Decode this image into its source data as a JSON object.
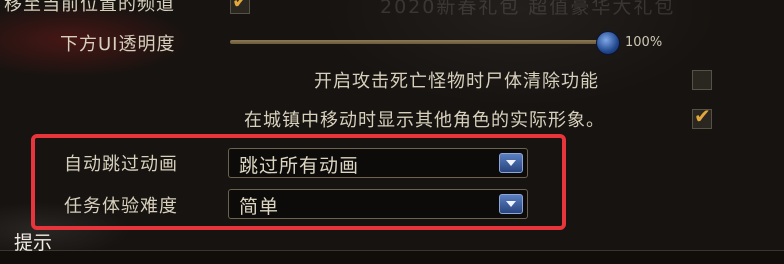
{
  "top_partial": {
    "label": "移至当前位置的频道",
    "checked": true,
    "banner_text": "2020新春礼包 超值豪华大礼包"
  },
  "opacity": {
    "label": "下方UI透明度",
    "value_text": "100%",
    "value_fraction": 1.0
  },
  "corpse_clear": {
    "label": "开启攻击死亡怪物时尸体清除功能",
    "checked": false
  },
  "town_display": {
    "label": "在城镇中移动时显示其他角色的实际形象。",
    "checked": true
  },
  "auto_skip": {
    "label": "自动跳过动画",
    "selected": "跳过所有动画"
  },
  "difficulty": {
    "label": "任务体验难度",
    "selected": "简单"
  },
  "hint": {
    "label": "提示"
  },
  "colors": {
    "highlight": "#e8343b",
    "check": "#e2a83c",
    "knob": "#23488e"
  },
  "icons": {
    "checkbox_checked": "check-icon",
    "dropdown": "chevron-down-icon"
  }
}
